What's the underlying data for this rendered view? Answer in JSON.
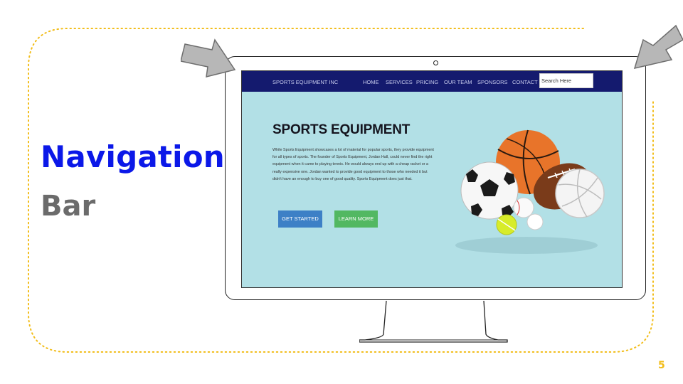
{
  "slide": {
    "title": "Navigation",
    "subtitle": "Bar",
    "page_number": "5"
  },
  "colors": {
    "title_blue": "#0b18e8",
    "subtitle_gray": "#6b6b6b",
    "accent_yellow": "#f2bd19",
    "nav_bg": "#141a6e",
    "hero_bg": "#b2e0e6",
    "btn_blue": "#3d80c6",
    "btn_green": "#52b862"
  },
  "site": {
    "brand": "SPORTS EQUIPMENT INC",
    "nav": [
      "HOME",
      "SERVICES",
      "PRICING",
      "OUR TEAM",
      "SPONSORS",
      "CONTACT"
    ],
    "search_value": "Search Here",
    "hero": {
      "title": "SPORTS EQUIPMENT",
      "text": "While Sports Equipment showcases a lot of material for popular sports, they provide equipment for all types of sports. The founder of Sports Equipment, Jordan Hall, could never find the right equipment when it came to playing tennis. He would always end up with a cheap racket or a really expensive one. Jordan wanted to provide good equipment to those who needed it but didn't have an enough to buy one of good quality. Sports Equipment does just that.",
      "primary_button": "GET STARTED",
      "secondary_button": "LEARN MORE"
    }
  },
  "icons": {
    "arrows": "pointer-arrow-icon",
    "balls": "sports-balls-image"
  }
}
